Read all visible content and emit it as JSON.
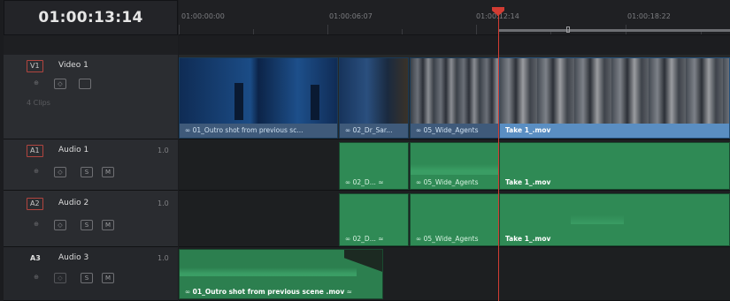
{
  "timecode": "01:00:13:14",
  "ruler": {
    "marks": [
      "01:00:00:00",
      "01:00:06:07",
      "01:00:12:14",
      "01:00:18:22"
    ]
  },
  "tracks": {
    "video1": {
      "badge": "V1",
      "name": "Video 1",
      "clip_count": "4 Clips"
    },
    "audio1": {
      "badge": "A1",
      "name": "Audio 1",
      "volume": "1.0",
      "solo": "S",
      "mute": "M"
    },
    "audio2": {
      "badge": "A2",
      "name": "Audio 2",
      "volume": "1.0",
      "solo": "S",
      "mute": "M"
    },
    "audio3": {
      "badge": "A3",
      "name": "Audio 3",
      "volume": "1.0",
      "solo": "S",
      "mute": "M"
    }
  },
  "clips": {
    "video": [
      {
        "label": "01_Outro shot from previous sc..."
      },
      {
        "label": "02_Dr_Sar..."
      },
      {
        "label": "05_Wide_Agents"
      },
      {
        "label": "Take 1_.mov"
      }
    ],
    "audio1": [
      {
        "label": "02_D..."
      },
      {
        "label": "05_Wide_Agents"
      },
      {
        "label": "Take 1_.mov"
      }
    ],
    "audio2": [
      {
        "label": "02_D..."
      },
      {
        "label": "05_Wide_Agents"
      },
      {
        "label": "Take 1_.mov"
      }
    ],
    "audio3": [
      {
        "label": "01_Outro shot from previous scene .mov"
      }
    ]
  },
  "colors": {
    "playhead": "#d23c33",
    "video_clip": "#3f5a7a",
    "audio_clip": "#2f8a55",
    "track_badge_border": "#b1453f"
  }
}
